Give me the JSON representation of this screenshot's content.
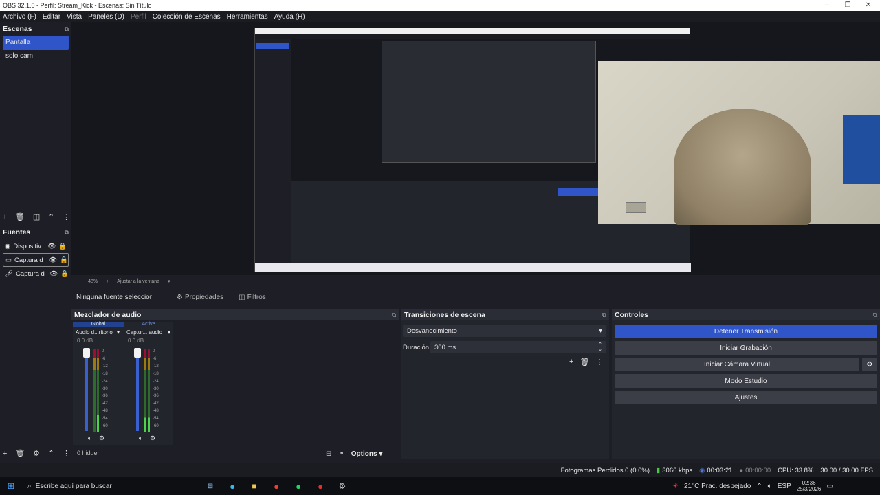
{
  "window": {
    "title": "OBS 32.1.0 - Perfil: Stream_Kick - Escenas: Sin Título",
    "minimize": "–",
    "maximize": "❐",
    "close": "✕"
  },
  "menu": [
    "Archivo (F)",
    "Editar",
    "Vista",
    "Paneles (D)",
    "Perfil",
    "Colección de Escenas",
    "Herramientas",
    "Ayuda (H)"
  ],
  "scenes": {
    "title": "Escenas",
    "items": [
      "Pantalla",
      "solo cam"
    ],
    "selected": 0
  },
  "sources": {
    "title": "Fuentes",
    "items": [
      {
        "label": "Dispositiv"
      },
      {
        "label": "Captura d"
      },
      {
        "label": "Captura d"
      }
    ]
  },
  "preview_bar": {
    "zoom_minus": "−",
    "zoom": "48%",
    "zoom_plus": "+",
    "fit": "Ajustar a la ventana"
  },
  "context": {
    "no_source": "Ninguna fuente seleccionac",
    "properties": "Propiedades",
    "filters": "Filtros"
  },
  "mixer": {
    "title": "Mezclador de audio",
    "tabs": [
      "Global",
      "Active"
    ],
    "channels": [
      {
        "name": "Audio d...ritorio",
        "db": "0.0 dB"
      },
      {
        "name": "Captur... audio",
        "db": "0.0 dB"
      }
    ],
    "scale": [
      "0",
      "-6",
      "-12",
      "-18",
      "-24",
      "-30",
      "-36",
      "-42",
      "-48",
      "-54",
      "-60"
    ],
    "hidden": "0 hidden",
    "options": "Options"
  },
  "transitions": {
    "title": "Transiciones de escena",
    "selected": "Desvanecimiento",
    "duration_label": "Duración",
    "duration_value": "300 ms"
  },
  "controls": {
    "title": "Controles",
    "buttons": [
      "Detener Transmisión",
      "Iniciar Grabación",
      "Iniciar Cámara Virtual",
      "Modo Estudio",
      "Ajustes"
    ],
    "accent": "#2f55c9"
  },
  "statusbar": {
    "dropped": "Fotogramas Perdidos 0 (0.0%)",
    "bitrate": "3066 kbps",
    "stream_time": "00:03:21",
    "rec_time": "00:00:00",
    "cpu": "CPU: 33.8%",
    "fps": "30.00 / 30.00 FPS"
  },
  "taskbar": {
    "search": "Escribe aquí para buscar",
    "weather": "21°C  Prac. despejado",
    "lang": "ESP",
    "time": "02:36",
    "date": "25/3/2026"
  },
  "colors": {
    "bg": "#1e1f26",
    "panel": "#272932",
    "selected": "#2f55c9"
  }
}
